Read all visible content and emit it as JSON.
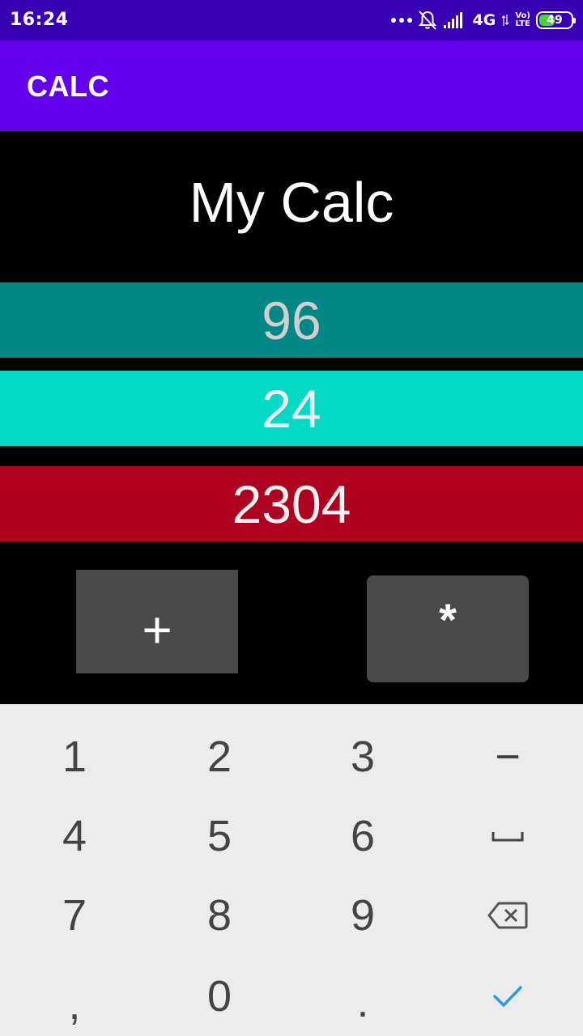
{
  "status_bar": {
    "time": "16:24",
    "network": "4G",
    "volte_top": "Vo)",
    "volte_bottom": "LTE",
    "battery": "49",
    "battery_level": 0.49,
    "icons": [
      "more-dots-icon",
      "notifications-off-icon",
      "signal-icon",
      "network-activity-icon",
      "volte-icon",
      "battery-icon"
    ]
  },
  "app_bar": {
    "title": "CALC"
  },
  "main": {
    "heading": "My Calc",
    "input_a": "96",
    "input_b": "24",
    "result": "2304",
    "plus_label": "+",
    "multiply_label": "*"
  },
  "keyboard": {
    "row1": [
      "1",
      "2",
      "3",
      "−"
    ],
    "row2": [
      "4",
      "5",
      "6"
    ],
    "row3": [
      "7",
      "8",
      "9"
    ],
    "row4": [
      ",",
      "0",
      "."
    ],
    "icons": [
      "space-icon",
      "backspace-icon",
      "done-check-icon"
    ]
  },
  "colors": {
    "status_bar": "#3700b3",
    "app_bar": "#6200ee",
    "input_a_bg": "#018786",
    "input_b_bg": "#03dac5",
    "result_bg": "#b00020",
    "button_bg": "#494949",
    "keyboard_bg": "#ececec",
    "done_accent": "#2e9be6"
  }
}
